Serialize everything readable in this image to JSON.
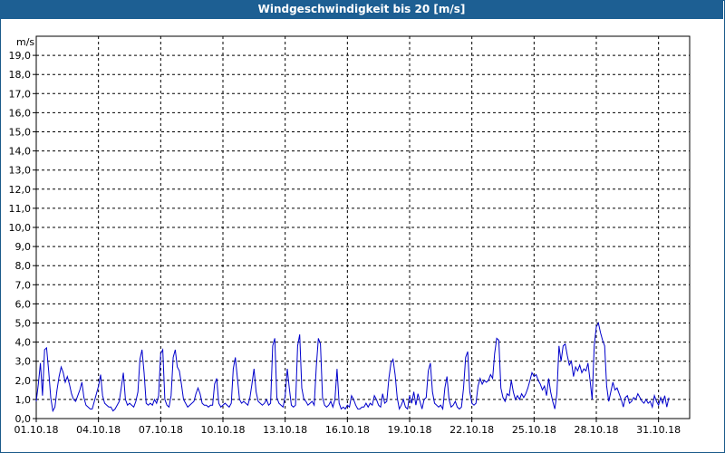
{
  "window": {
    "title": "Windgeschwindigkeit bis 20 [m/s]"
  },
  "chart_data": {
    "type": "line",
    "title": "Windgeschwindigkeit bis 20 [m/s]",
    "ylabel": "m/s",
    "xlabel": "",
    "ylim": [
      0,
      20
    ],
    "xlim": [
      0,
      31.5
    ],
    "grid": true,
    "line_color": "#0000cc",
    "y_ticks": [
      "0,0",
      "1,0",
      "2,0",
      "3,0",
      "4,0",
      "5,0",
      "6,0",
      "7,0",
      "8,0",
      "9,0",
      "10,0",
      "11,0",
      "12,0",
      "13,0",
      "14,0",
      "15,0",
      "16,0",
      "17,0",
      "18,0",
      "19,0"
    ],
    "x_ticks": [
      {
        "v": 0,
        "label": "01.10.18"
      },
      {
        "v": 3,
        "label": "04.10.18"
      },
      {
        "v": 6,
        "label": "07.10.18"
      },
      {
        "v": 9,
        "label": "10.10.18"
      },
      {
        "v": 12,
        "label": "13.10.18"
      },
      {
        "v": 15,
        "label": "16.10.18"
      },
      {
        "v": 18,
        "label": "19.10.18"
      },
      {
        "v": 21,
        "label": "22.10.18"
      },
      {
        "v": 24,
        "label": "25.10.18"
      },
      {
        "v": 27,
        "label": "28.10.18"
      },
      {
        "v": 30,
        "label": "31.10.18"
      }
    ],
    "series": [
      {
        "points": [
          [
            0.0,
            0.9
          ],
          [
            0.1,
            1.8
          ],
          [
            0.2,
            2.9
          ],
          [
            0.3,
            1.2
          ],
          [
            0.4,
            3.6
          ],
          [
            0.5,
            3.7
          ],
          [
            0.6,
            2.5
          ],
          [
            0.7,
            1.1
          ],
          [
            0.8,
            0.4
          ],
          [
            0.9,
            0.6
          ],
          [
            1.0,
            1.5
          ],
          [
            1.1,
            2.2
          ],
          [
            1.2,
            2.7
          ],
          [
            1.3,
            2.4
          ],
          [
            1.4,
            1.9
          ],
          [
            1.5,
            2.2
          ],
          [
            1.6,
            1.8
          ],
          [
            1.7,
            1.3
          ],
          [
            1.8,
            1.0
          ],
          [
            1.9,
            0.9
          ],
          [
            2.0,
            1.2
          ],
          [
            2.1,
            1.5
          ],
          [
            2.2,
            1.9
          ],
          [
            2.3,
            1.1
          ],
          [
            2.4,
            0.7
          ],
          [
            2.5,
            0.6
          ],
          [
            2.6,
            0.5
          ],
          [
            2.7,
            0.5
          ],
          [
            2.8,
            0.9
          ],
          [
            2.9,
            1.3
          ],
          [
            3.0,
            1.7
          ],
          [
            3.1,
            2.3
          ],
          [
            3.2,
            1.2
          ],
          [
            3.3,
            0.8
          ],
          [
            3.4,
            0.7
          ],
          [
            3.5,
            0.6
          ],
          [
            3.6,
            0.6
          ],
          [
            3.7,
            0.4
          ],
          [
            3.8,
            0.5
          ],
          [
            3.9,
            0.7
          ],
          [
            4.0,
            0.9
          ],
          [
            4.1,
            1.6
          ],
          [
            4.2,
            2.4
          ],
          [
            4.3,
            1.0
          ],
          [
            4.4,
            0.7
          ],
          [
            4.5,
            0.8
          ],
          [
            4.6,
            0.7
          ],
          [
            4.7,
            0.6
          ],
          [
            4.8,
            0.9
          ],
          [
            4.9,
            1.4
          ],
          [
            5.0,
            3.1
          ],
          [
            5.1,
            3.6
          ],
          [
            5.2,
            2.4
          ],
          [
            5.3,
            0.8
          ],
          [
            5.4,
            0.7
          ],
          [
            5.5,
            0.8
          ],
          [
            5.6,
            0.7
          ],
          [
            5.7,
            1.0
          ],
          [
            5.8,
            0.8
          ],
          [
            5.9,
            1.2
          ],
          [
            6.0,
            3.4
          ],
          [
            6.1,
            3.6
          ],
          [
            6.2,
            1.0
          ],
          [
            6.3,
            0.7
          ],
          [
            6.4,
            0.6
          ],
          [
            6.5,
            1.2
          ],
          [
            6.6,
            3.2
          ],
          [
            6.7,
            3.6
          ],
          [
            6.8,
            2.7
          ],
          [
            6.9,
            2.5
          ],
          [
            7.0,
            1.8
          ],
          [
            7.1,
            1.0
          ],
          [
            7.2,
            0.8
          ],
          [
            7.3,
            0.6
          ],
          [
            7.4,
            0.7
          ],
          [
            7.5,
            0.8
          ],
          [
            7.6,
            0.9
          ],
          [
            7.7,
            1.3
          ],
          [
            7.8,
            1.6
          ],
          [
            7.9,
            1.3
          ],
          [
            8.0,
            0.8
          ],
          [
            8.1,
            0.7
          ],
          [
            8.2,
            0.7
          ],
          [
            8.3,
            0.6
          ],
          [
            8.4,
            0.7
          ],
          [
            8.5,
            0.7
          ],
          [
            8.6,
            1.8
          ],
          [
            8.7,
            2.1
          ],
          [
            8.8,
            0.8
          ],
          [
            8.9,
            0.6
          ],
          [
            9.0,
            0.7
          ],
          [
            9.1,
            0.8
          ],
          [
            9.2,
            0.7
          ],
          [
            9.3,
            0.6
          ],
          [
            9.4,
            0.8
          ],
          [
            9.5,
            2.6
          ],
          [
            9.6,
            3.2
          ],
          [
            9.7,
            2.1
          ],
          [
            9.8,
            1.0
          ],
          [
            9.9,
            0.8
          ],
          [
            10.0,
            0.9
          ],
          [
            10.1,
            0.8
          ],
          [
            10.2,
            0.7
          ],
          [
            10.3,
            1.1
          ],
          [
            10.4,
            1.8
          ],
          [
            10.5,
            2.6
          ],
          [
            10.6,
            1.4
          ],
          [
            10.7,
            0.9
          ],
          [
            10.8,
            0.8
          ],
          [
            10.9,
            0.7
          ],
          [
            11.0,
            0.8
          ],
          [
            11.1,
            1.0
          ],
          [
            11.2,
            0.7
          ],
          [
            11.3,
            0.8
          ],
          [
            11.4,
            3.8
          ],
          [
            11.5,
            4.2
          ],
          [
            11.6,
            1.1
          ],
          [
            11.7,
            0.8
          ],
          [
            11.8,
            0.7
          ],
          [
            11.9,
            0.6
          ],
          [
            12.0,
            1.2
          ],
          [
            12.1,
            2.6
          ],
          [
            12.2,
            1.6
          ],
          [
            12.3,
            0.7
          ],
          [
            12.4,
            0.6
          ],
          [
            12.5,
            0.7
          ],
          [
            12.6,
            3.8
          ],
          [
            12.7,
            4.4
          ],
          [
            12.8,
            1.6
          ],
          [
            12.9,
            1.0
          ],
          [
            13.0,
            0.9
          ],
          [
            13.1,
            0.7
          ],
          [
            13.2,
            0.8
          ],
          [
            13.3,
            0.9
          ],
          [
            13.4,
            0.7
          ],
          [
            13.5,
            2.7
          ],
          [
            13.6,
            4.2
          ],
          [
            13.7,
            3.9
          ],
          [
            13.8,
            1.1
          ],
          [
            13.9,
            0.7
          ],
          [
            14.0,
            0.6
          ],
          [
            14.1,
            0.7
          ],
          [
            14.2,
            0.9
          ],
          [
            14.3,
            0.6
          ],
          [
            14.4,
            1.0
          ],
          [
            14.5,
            2.6
          ],
          [
            14.6,
            0.8
          ],
          [
            14.7,
            0.5
          ],
          [
            14.8,
            0.6
          ],
          [
            14.9,
            0.5
          ],
          [
            15.0,
            0.7
          ],
          [
            15.1,
            0.6
          ],
          [
            15.2,
            1.2
          ],
          [
            15.3,
            1.0
          ],
          [
            15.4,
            0.7
          ],
          [
            15.5,
            0.5
          ],
          [
            15.6,
            0.5
          ],
          [
            15.7,
            0.6
          ],
          [
            15.8,
            0.6
          ],
          [
            15.9,
            0.8
          ],
          [
            16.0,
            0.6
          ],
          [
            16.1,
            0.8
          ],
          [
            16.2,
            0.7
          ],
          [
            16.3,
            1.2
          ],
          [
            16.4,
            1.0
          ],
          [
            16.5,
            0.7
          ],
          [
            16.6,
            0.6
          ],
          [
            16.7,
            1.3
          ],
          [
            16.8,
            0.8
          ],
          [
            16.9,
            0.9
          ],
          [
            17.0,
            2.1
          ],
          [
            17.1,
            2.9
          ],
          [
            17.2,
            3.1
          ],
          [
            17.3,
            2.3
          ],
          [
            17.4,
            1.1
          ],
          [
            17.5,
            0.5
          ],
          [
            17.6,
            0.7
          ],
          [
            17.7,
            1.0
          ],
          [
            17.8,
            0.6
          ],
          [
            17.9,
            0.5
          ],
          [
            18.0,
            1.2
          ],
          [
            18.1,
            0.8
          ],
          [
            18.2,
            1.4
          ],
          [
            18.3,
            0.7
          ],
          [
            18.4,
            1.3
          ],
          [
            18.5,
            0.9
          ],
          [
            18.6,
            0.5
          ],
          [
            18.7,
            1.0
          ],
          [
            18.8,
            1.1
          ],
          [
            18.9,
            2.5
          ],
          [
            19.0,
            2.9
          ],
          [
            19.1,
            1.4
          ],
          [
            19.2,
            0.8
          ],
          [
            19.3,
            0.7
          ],
          [
            19.4,
            0.6
          ],
          [
            19.5,
            0.7
          ],
          [
            19.6,
            0.5
          ],
          [
            19.7,
            1.6
          ],
          [
            19.8,
            2.2
          ],
          [
            19.9,
            1.0
          ],
          [
            20.0,
            0.6
          ],
          [
            20.1,
            0.7
          ],
          [
            20.2,
            0.9
          ],
          [
            20.3,
            0.6
          ],
          [
            20.4,
            0.5
          ],
          [
            20.5,
            0.6
          ],
          [
            20.6,
            1.6
          ],
          [
            20.7,
            3.2
          ],
          [
            20.8,
            3.5
          ],
          [
            20.9,
            1.4
          ],
          [
            21.0,
            0.8
          ],
          [
            21.1,
            0.7
          ],
          [
            21.2,
            0.8
          ],
          [
            21.3,
            1.7
          ],
          [
            21.4,
            2.1
          ],
          [
            21.5,
            1.8
          ],
          [
            21.6,
            2.0
          ],
          [
            21.7,
            1.9
          ],
          [
            21.8,
            2.0
          ],
          [
            21.9,
            2.3
          ],
          [
            22.0,
            2.1
          ],
          [
            22.1,
            3.4
          ],
          [
            22.2,
            4.2
          ],
          [
            22.3,
            4.1
          ],
          [
            22.4,
            1.6
          ],
          [
            22.5,
            1.1
          ],
          [
            22.6,
            0.9
          ],
          [
            22.7,
            1.3
          ],
          [
            22.8,
            1.2
          ],
          [
            22.9,
            2.0
          ],
          [
            23.0,
            1.4
          ],
          [
            23.1,
            1.0
          ],
          [
            23.2,
            1.2
          ],
          [
            23.3,
            1.0
          ],
          [
            23.4,
            1.3
          ],
          [
            23.5,
            1.1
          ],
          [
            23.6,
            1.3
          ],
          [
            23.7,
            1.6
          ],
          [
            23.8,
            2.0
          ],
          [
            23.9,
            2.4
          ],
          [
            24.0,
            2.2
          ],
          [
            24.1,
            2.3
          ],
          [
            24.2,
            2.0
          ],
          [
            24.3,
            1.8
          ],
          [
            24.4,
            1.5
          ],
          [
            24.5,
            1.7
          ],
          [
            24.6,
            1.2
          ],
          [
            24.7,
            2.1
          ],
          [
            24.8,
            1.4
          ],
          [
            24.9,
            0.9
          ],
          [
            25.0,
            0.5
          ],
          [
            25.1,
            1.3
          ],
          [
            25.2,
            3.8
          ],
          [
            25.3,
            3.0
          ],
          [
            25.4,
            3.8
          ],
          [
            25.5,
            3.9
          ],
          [
            25.6,
            3.3
          ],
          [
            25.7,
            2.8
          ],
          [
            25.8,
            3.0
          ],
          [
            25.9,
            2.2
          ],
          [
            26.0,
            2.7
          ],
          [
            26.1,
            2.5
          ],
          [
            26.2,
            2.8
          ],
          [
            26.3,
            2.4
          ],
          [
            26.4,
            2.6
          ],
          [
            26.5,
            2.5
          ],
          [
            26.6,
            2.9
          ],
          [
            26.7,
            2.0
          ],
          [
            26.8,
            1.0
          ],
          [
            26.9,
            3.8
          ],
          [
            27.0,
            4.8
          ],
          [
            27.1,
            5.0
          ],
          [
            27.2,
            4.5
          ],
          [
            27.3,
            4.1
          ],
          [
            27.4,
            3.8
          ],
          [
            27.5,
            1.7
          ],
          [
            27.6,
            0.9
          ],
          [
            27.7,
            1.4
          ],
          [
            27.8,
            1.9
          ],
          [
            27.9,
            1.5
          ],
          [
            28.0,
            1.6
          ],
          [
            28.1,
            1.3
          ],
          [
            28.2,
            1.0
          ],
          [
            28.3,
            0.6
          ],
          [
            28.4,
            1.1
          ],
          [
            28.5,
            1.2
          ],
          [
            28.6,
            0.8
          ],
          [
            28.7,
            0.9
          ],
          [
            28.8,
            1.1
          ],
          [
            28.9,
            1.0
          ],
          [
            29.0,
            1.3
          ],
          [
            29.1,
            1.1
          ],
          [
            29.2,
            0.9
          ],
          [
            29.3,
            0.8
          ],
          [
            29.4,
            1.0
          ],
          [
            29.5,
            0.8
          ],
          [
            29.6,
            0.9
          ],
          [
            29.7,
            0.6
          ],
          [
            29.8,
            1.2
          ],
          [
            29.9,
            0.9
          ],
          [
            30.0,
            0.7
          ],
          [
            30.1,
            1.1
          ],
          [
            30.2,
            0.8
          ],
          [
            30.3,
            1.2
          ],
          [
            30.4,
            0.6
          ],
          [
            30.5,
            1.1
          ]
        ]
      }
    ]
  }
}
